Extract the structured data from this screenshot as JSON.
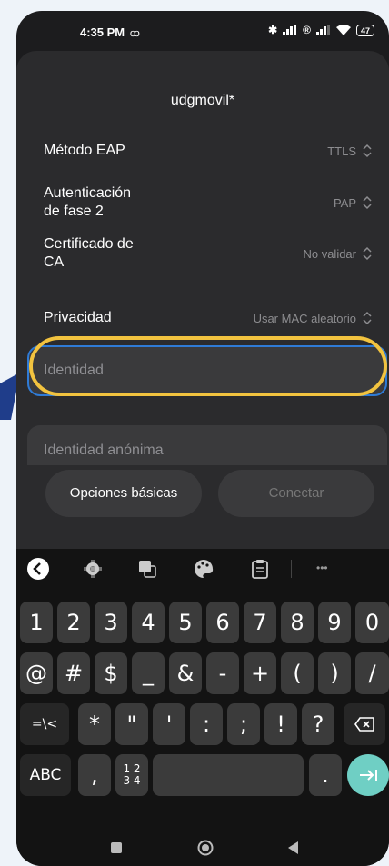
{
  "status_bar": {
    "time": "4:35 PM",
    "voicemail": "ꝏ",
    "battery": "47"
  },
  "dialog": {
    "title": "udgmovil*",
    "settings": [
      {
        "label": "Método EAP",
        "value": "TTLS"
      },
      {
        "label": "Autenticación\nde fase 2",
        "value": "PAP"
      },
      {
        "label": "Certificado de\nCA",
        "value": "No validar"
      },
      {
        "label": "Privacidad",
        "value": "Usar MAC aleatorio"
      }
    ],
    "identity_placeholder": "Identidad",
    "anonymous_identity_placeholder": "Identidad anónima",
    "basic_options_label": "Opciones básicas",
    "connect_label": "Conectar"
  },
  "keyboard": {
    "toolbar_more": "•••",
    "row1": [
      "1",
      "2",
      "3",
      "4",
      "5",
      "6",
      "7",
      "8",
      "9",
      "0"
    ],
    "row2": [
      "@",
      "#",
      "$",
      "_",
      "&",
      "-",
      "+",
      "(",
      ")",
      "/"
    ],
    "row3": [
      "=\\<",
      "*",
      "\"",
      "'",
      ":",
      ";",
      "!",
      "?"
    ],
    "abc_label": "ABC",
    "comma_label": ",",
    "numpad_label_top": "1 2",
    "numpad_label_bottom": "3 4",
    "period_label": "."
  },
  "colors": {
    "accent_highlight": "#f2c33f",
    "focus_border": "#2f7bd6",
    "enter_key": "#6fcfc4"
  }
}
